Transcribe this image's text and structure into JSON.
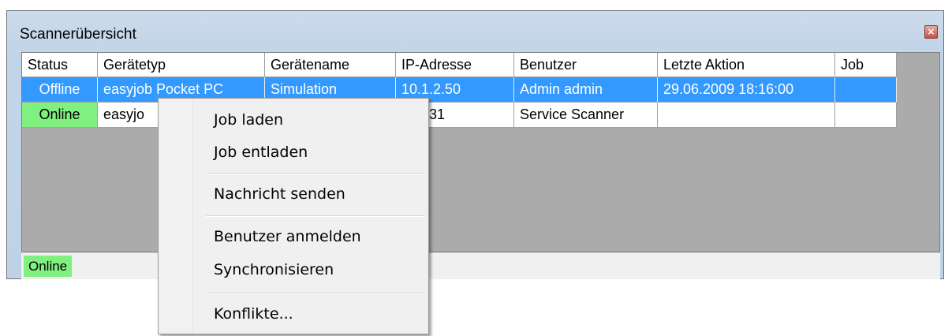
{
  "window": {
    "title": "Scannerübersicht",
    "close_symbol": "×",
    "close_icon": "close-icon"
  },
  "grid": {
    "columns": [
      {
        "key": "status",
        "label": "Status"
      },
      {
        "key": "geraetetyp",
        "label": "Gerätetyp"
      },
      {
        "key": "geraetename",
        "label": "Gerätename"
      },
      {
        "key": "ip",
        "label": "IP-Adresse"
      },
      {
        "key": "benutzer",
        "label": "Benutzer"
      },
      {
        "key": "letzte_aktion",
        "label": "Letzte Aktion"
      },
      {
        "key": "job",
        "label": "Job"
      }
    ],
    "rows": [
      {
        "status": "Offline",
        "geraetetyp": "easyjob Pocket PC",
        "geraetename": "Simulation",
        "ip": "10.1.2.50",
        "benutzer": "Admin admin",
        "letzte_aktion": "29.06.2009 18:16:00",
        "job": "",
        "selected": true
      },
      {
        "status": "Online",
        "geraetetyp": "easyjo",
        "geraetename": "",
        "ip": ".1.2.31",
        "benutzer": "Service Scanner",
        "letzte_aktion": "",
        "job": "",
        "selected": false
      }
    ]
  },
  "statusbar": {
    "status": "Online"
  },
  "context_menu": {
    "items": [
      "Job laden",
      "Job entladen",
      "Nachricht senden",
      "Benutzer anmelden",
      "Synchronisieren",
      "Konflikte..."
    ]
  },
  "colors": {
    "selection": "#3399ff",
    "online": "#80f080",
    "grid_background": "#ababab",
    "window_frame": "#bed2e6"
  }
}
